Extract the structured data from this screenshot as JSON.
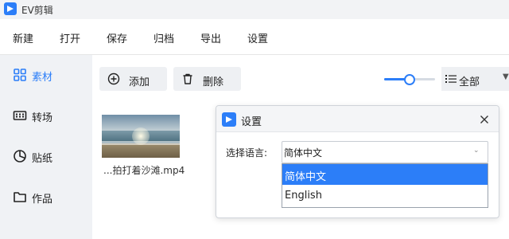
{
  "app": {
    "title": "EV剪辑"
  },
  "menu": [
    "新建",
    "打开",
    "保存",
    "归档",
    "导出",
    "设置"
  ],
  "sidebar": {
    "items": [
      {
        "label": "素材",
        "icon": "grid-icon",
        "active": true
      },
      {
        "label": "转场",
        "icon": "film-strip-icon"
      },
      {
        "label": "贴纸",
        "icon": "pie-chart-icon"
      },
      {
        "label": "作品",
        "icon": "folder-icon"
      }
    ]
  },
  "toolbar": {
    "add_label": "添加",
    "delete_label": "删除",
    "filter_value": "全部",
    "zoom_level": 0.5
  },
  "media": [
    {
      "name": "...拍打着沙滩.mp4"
    }
  ],
  "dialog": {
    "title": "设置",
    "language_label": "选择语言:",
    "selected_value": "简体中文",
    "options": [
      "简体中文",
      "English"
    ]
  },
  "colors": {
    "accent": "#2c7ef8",
    "sidebar_bg": "#f0f2f5"
  }
}
